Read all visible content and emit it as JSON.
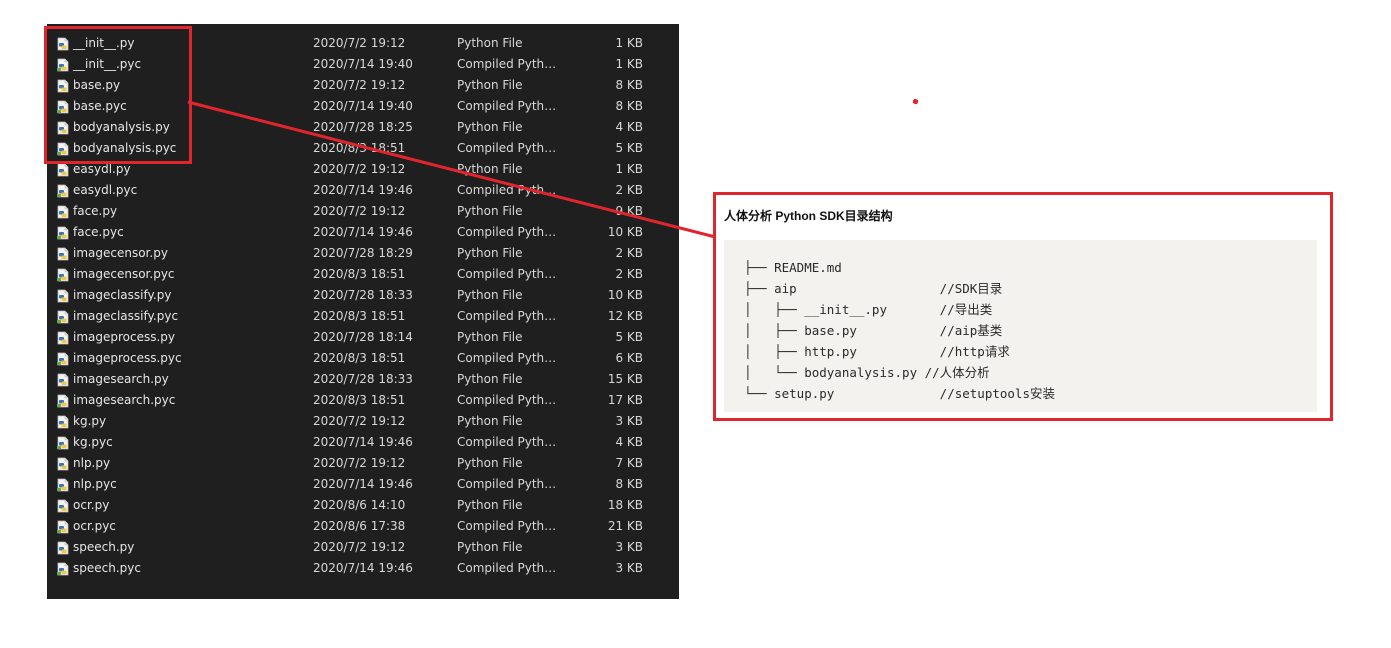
{
  "explorer": {
    "files": [
      {
        "name": "__init__.py",
        "date": "2020/7/2 19:12",
        "type": "Python File",
        "size": "1 KB",
        "icon": "python-file-icon"
      },
      {
        "name": "__init__.pyc",
        "date": "2020/7/14 19:40",
        "type": "Compiled Pytho...",
        "size": "1 KB",
        "icon": "compiled-python-icon"
      },
      {
        "name": "base.py",
        "date": "2020/7/2 19:12",
        "type": "Python File",
        "size": "8 KB",
        "icon": "python-file-icon"
      },
      {
        "name": "base.pyc",
        "date": "2020/7/14 19:40",
        "type": "Compiled Pytho...",
        "size": "8 KB",
        "icon": "compiled-python-icon"
      },
      {
        "name": "bodyanalysis.py",
        "date": "2020/7/28 18:25",
        "type": "Python File",
        "size": "4 KB",
        "icon": "python-file-icon"
      },
      {
        "name": "bodyanalysis.pyc",
        "date": "2020/8/3 18:51",
        "type": "Compiled Pytho...",
        "size": "5 KB",
        "icon": "compiled-python-icon"
      },
      {
        "name": "easydl.py",
        "date": "2020/7/2 19:12",
        "type": "Python File",
        "size": "1 KB",
        "icon": "python-file-icon"
      },
      {
        "name": "easydl.pyc",
        "date": "2020/7/14 19:46",
        "type": "Compiled Pytho...",
        "size": "2 KB",
        "icon": "compiled-python-icon"
      },
      {
        "name": "face.py",
        "date": "2020/7/2 19:12",
        "type": "Python File",
        "size": "9 KB",
        "icon": "python-file-icon"
      },
      {
        "name": "face.pyc",
        "date": "2020/7/14 19:46",
        "type": "Compiled Pytho...",
        "size": "10 KB",
        "icon": "compiled-python-icon"
      },
      {
        "name": "imagecensor.py",
        "date": "2020/7/28 18:29",
        "type": "Python File",
        "size": "2 KB",
        "icon": "python-file-icon"
      },
      {
        "name": "imagecensor.pyc",
        "date": "2020/8/3 18:51",
        "type": "Compiled Pytho...",
        "size": "2 KB",
        "icon": "compiled-python-icon"
      },
      {
        "name": "imageclassify.py",
        "date": "2020/7/28 18:33",
        "type": "Python File",
        "size": "10 KB",
        "icon": "python-file-icon"
      },
      {
        "name": "imageclassify.pyc",
        "date": "2020/8/3 18:51",
        "type": "Compiled Pytho...",
        "size": "12 KB",
        "icon": "compiled-python-icon"
      },
      {
        "name": "imageprocess.py",
        "date": "2020/7/28 18:14",
        "type": "Python File",
        "size": "5 KB",
        "icon": "python-file-icon"
      },
      {
        "name": "imageprocess.pyc",
        "date": "2020/8/3 18:51",
        "type": "Compiled Pytho...",
        "size": "6 KB",
        "icon": "compiled-python-icon"
      },
      {
        "name": "imagesearch.py",
        "date": "2020/7/28 18:33",
        "type": "Python File",
        "size": "15 KB",
        "icon": "python-file-icon"
      },
      {
        "name": "imagesearch.pyc",
        "date": "2020/8/3 18:51",
        "type": "Compiled Pytho...",
        "size": "17 KB",
        "icon": "compiled-python-icon"
      },
      {
        "name": "kg.py",
        "date": "2020/7/2 19:12",
        "type": "Python File",
        "size": "3 KB",
        "icon": "python-file-icon"
      },
      {
        "name": "kg.pyc",
        "date": "2020/7/14 19:46",
        "type": "Compiled Pytho...",
        "size": "4 KB",
        "icon": "compiled-python-icon"
      },
      {
        "name": "nlp.py",
        "date": "2020/7/2 19:12",
        "type": "Python File",
        "size": "7 KB",
        "icon": "python-file-icon"
      },
      {
        "name": "nlp.pyc",
        "date": "2020/7/14 19:46",
        "type": "Compiled Pytho...",
        "size": "8 KB",
        "icon": "compiled-python-icon"
      },
      {
        "name": "ocr.py",
        "date": "2020/8/6 14:10",
        "type": "Python File",
        "size": "18 KB",
        "icon": "python-file-icon"
      },
      {
        "name": "ocr.pyc",
        "date": "2020/8/6 17:38",
        "type": "Compiled Pytho...",
        "size": "21 KB",
        "icon": "compiled-python-icon"
      },
      {
        "name": "speech.py",
        "date": "2020/7/2 19:12",
        "type": "Python File",
        "size": "3 KB",
        "icon": "python-file-icon"
      },
      {
        "name": "speech.pyc",
        "date": "2020/7/14 19:46",
        "type": "Compiled Pytho...",
        "size": "3 KB",
        "icon": "compiled-python-icon"
      }
    ]
  },
  "doc": {
    "title": "人体分析 Python SDK目录结构",
    "lines": [
      "├── README.md",
      "├── aip                   //SDK目录",
      "│   ├── __init__.py       //导出类",
      "│   ├── base.py           //aip基类",
      "│   ├── http.py           //http请求",
      "│   └── bodyanalysis.py //人体分析",
      "└── setup.py              //setuptools安装"
    ]
  },
  "colors": {
    "annotation": "#e0262c",
    "explorer_bg": "#1f1f1f",
    "code_bg": "#f4f2ee"
  }
}
